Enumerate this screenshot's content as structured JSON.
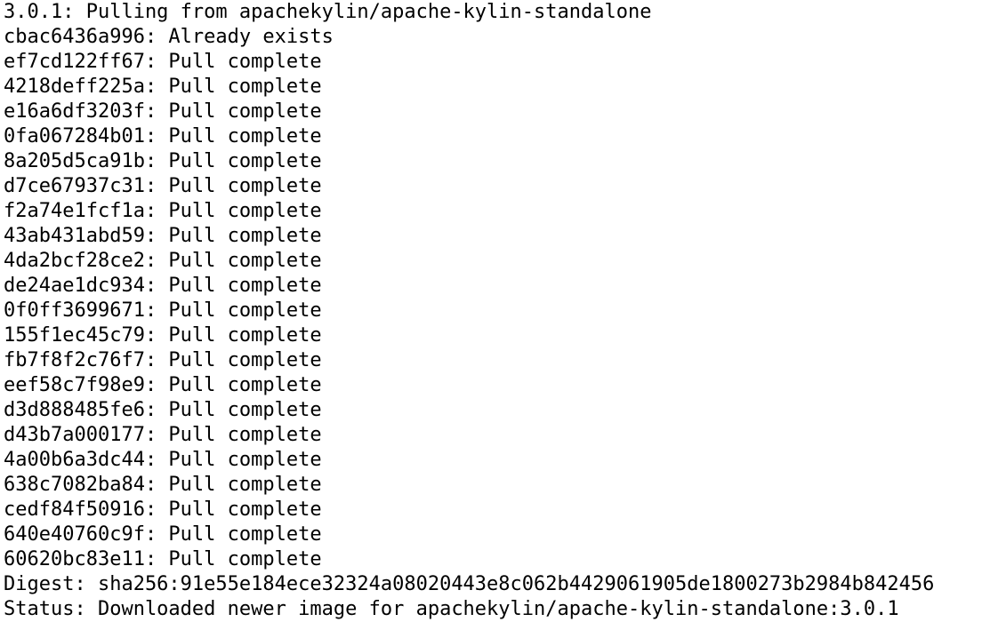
{
  "terminal": {
    "header": "3.0.1: Pulling from apachekylin/apache-kylin-standalone",
    "layers": [
      "cbac6436a996: Already exists",
      "ef7cd122ff67: Pull complete",
      "4218deff225a: Pull complete",
      "e16a6df3203f: Pull complete",
      "0fa067284b01: Pull complete",
      "8a205d5ca91b: Pull complete",
      "d7ce67937c31: Pull complete",
      "f2a74e1fcf1a: Pull complete",
      "43ab431abd59: Pull complete",
      "4da2bcf28ce2: Pull complete",
      "de24ae1dc934: Pull complete",
      "0f0ff3699671: Pull complete",
      "155f1ec45c79: Pull complete",
      "fb7f8f2c76f7: Pull complete",
      "eef58c7f98e9: Pull complete",
      "d3d888485fe6: Pull complete",
      "d43b7a000177: Pull complete",
      "4a00b6a3dc44: Pull complete",
      "638c7082ba84: Pull complete",
      "cedf84f50916: Pull complete",
      "640e40760c9f: Pull complete",
      "60620bc83e11: Pull complete"
    ],
    "digest": "Digest: sha256:91e55e184ece32324a08020443e8c062b4429061905de1800273b2984b842456",
    "status": "Status: Downloaded newer image for apachekylin/apache-kylin-standalone:3.0.1"
  }
}
